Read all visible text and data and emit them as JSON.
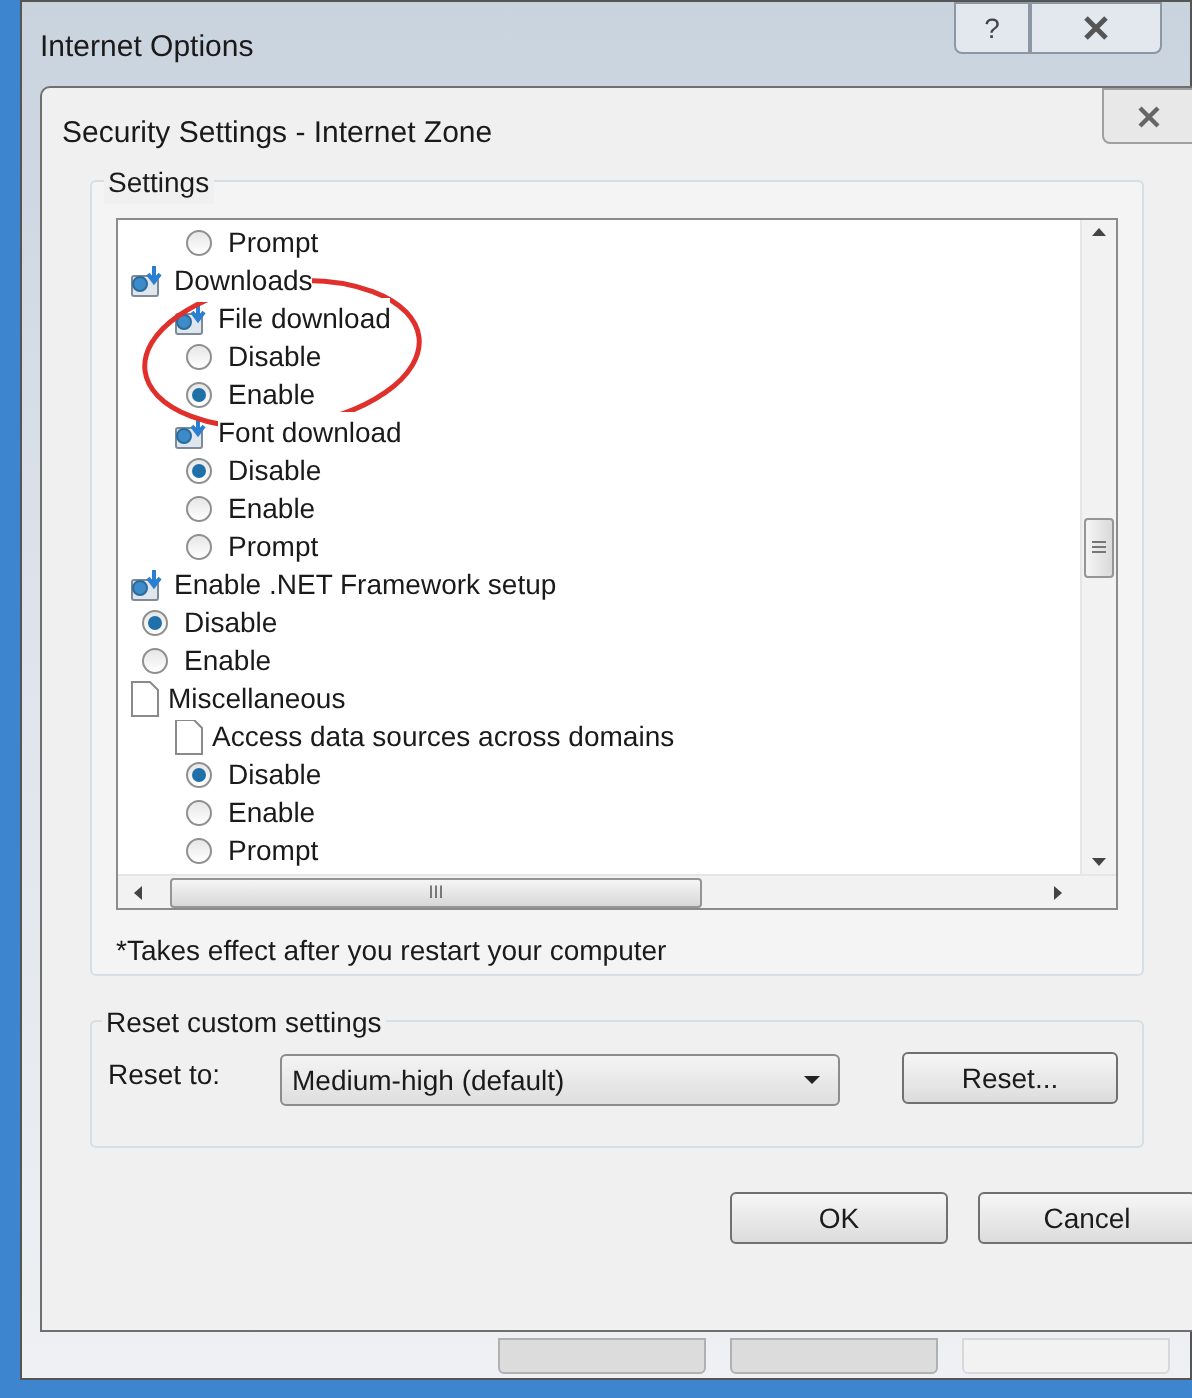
{
  "window": {
    "title": "Internet Options",
    "help_button": "?"
  },
  "dialog": {
    "title": "Security Settings - Internet Zone"
  },
  "settings": {
    "label": "Settings",
    "tree": [
      {
        "kind": "offscreen",
        "children": [
          {
            "kind": "offscreen",
            "children": [
              {
                "kind": "radio",
                "label": "Prompt",
                "selected": false
              }
            ]
          }
        ]
      },
      {
        "kind": "folder",
        "label": "Downloads",
        "children": [
          {
            "kind": "folder",
            "label": "File download",
            "children": [
              {
                "kind": "radio",
                "label": "Disable",
                "selected": false
              },
              {
                "kind": "radio",
                "label": "Enable",
                "selected": true
              }
            ]
          },
          {
            "kind": "folder",
            "label": "Font download",
            "children": [
              {
                "kind": "radio",
                "label": "Disable",
                "selected": true
              },
              {
                "kind": "radio",
                "label": "Enable",
                "selected": false
              },
              {
                "kind": "radio",
                "label": "Prompt",
                "selected": false
              }
            ]
          }
        ]
      },
      {
        "kind": "folder",
        "label": "Enable .NET Framework setup",
        "children": [
          {
            "kind": "radio",
            "label": "Disable",
            "selected": true
          },
          {
            "kind": "radio",
            "label": "Enable",
            "selected": false
          }
        ]
      },
      {
        "kind": "page",
        "label": "Miscellaneous",
        "children": [
          {
            "kind": "page",
            "label": "Access data sources across domains",
            "children": [
              {
                "kind": "radio",
                "label": "Disable",
                "selected": true
              },
              {
                "kind": "radio",
                "label": "Enable",
                "selected": false
              },
              {
                "kind": "radio",
                "label": "Prompt",
                "selected": false
              }
            ]
          }
        ]
      }
    ],
    "hscroll_grip": "III",
    "note": "*Takes effect after you restart your computer"
  },
  "reset": {
    "label": "Reset custom settings",
    "field_label": "Reset to:",
    "value": "Medium-high (default)",
    "button": "Reset..."
  },
  "buttons": [
    "OK",
    "Cancel"
  ]
}
